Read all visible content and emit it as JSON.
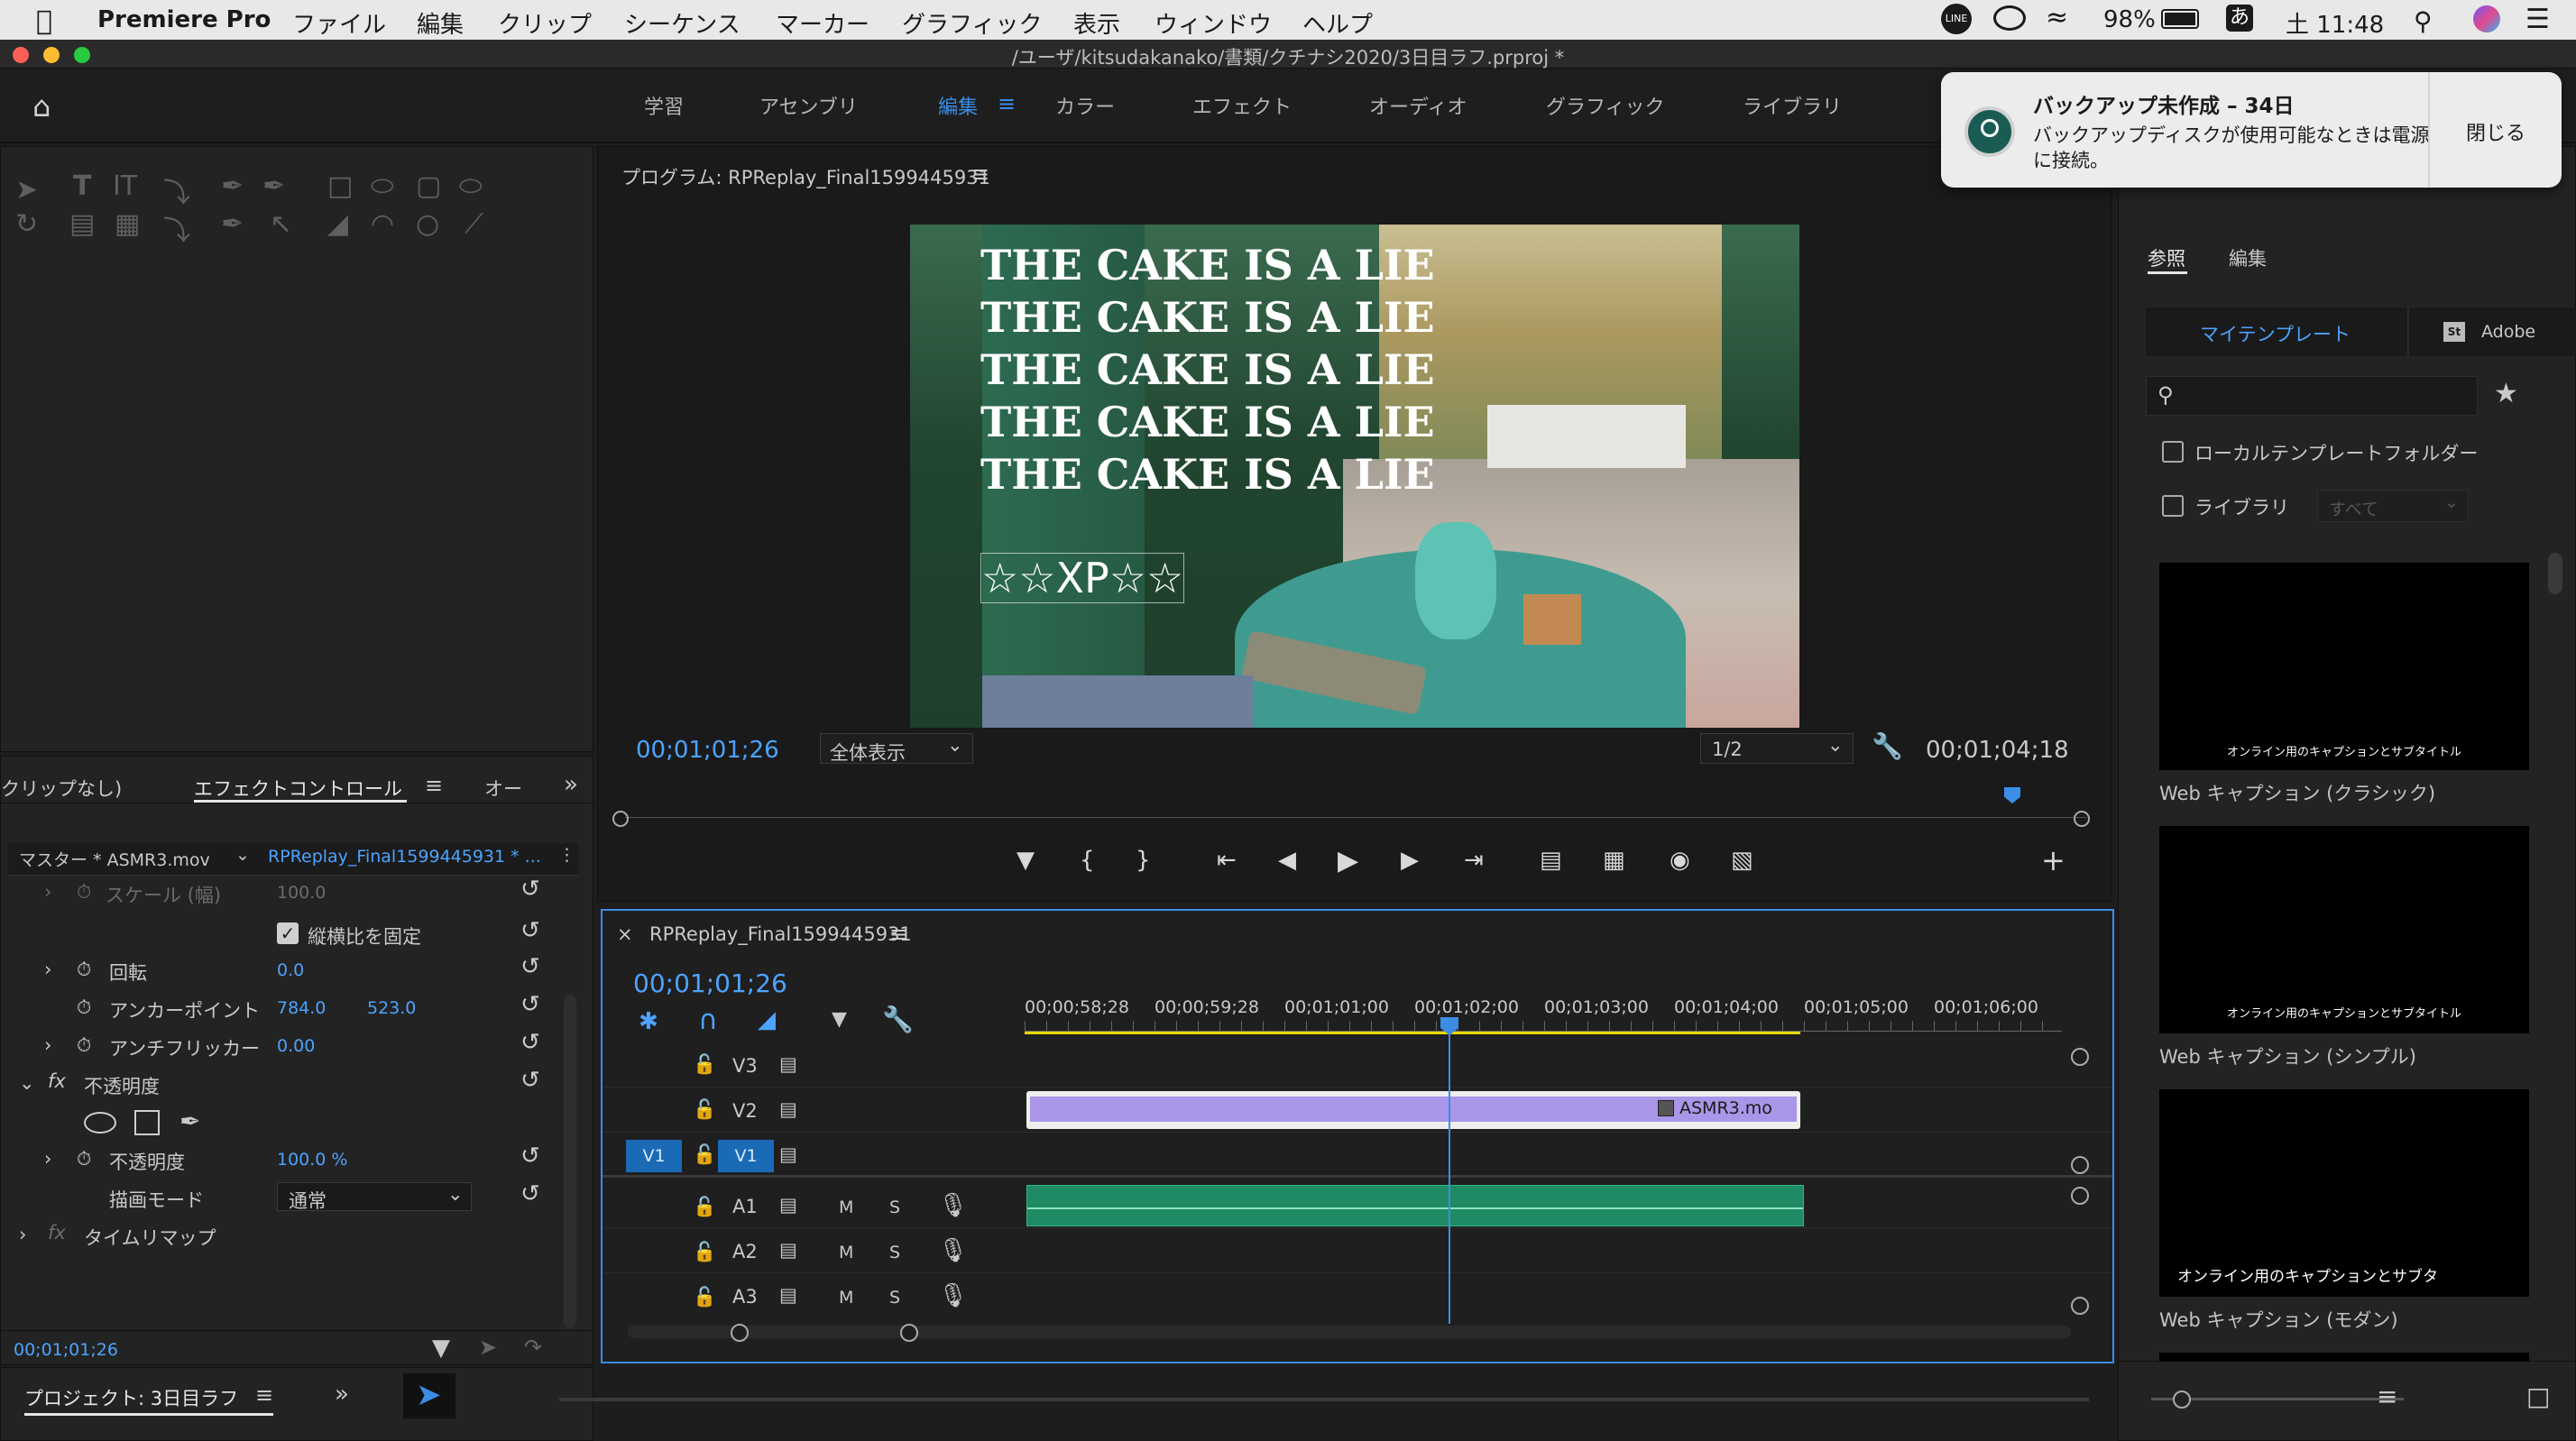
{
  "menubar": {
    "app_name": "Premiere Pro",
    "items": [
      "ファイル",
      "編集",
      "クリップ",
      "シーケンス",
      "マーカー",
      "グラフィック",
      "表示",
      "ウィンドウ",
      "ヘルプ"
    ],
    "battery": "98%",
    "input_mode": "あ",
    "clock": "土 11:48"
  },
  "titlebar": {
    "path": "/ユーザ/kitsudakanako/書類/クチナシ2020/3日目ラフ.prproj *"
  },
  "workspaces": [
    "学習",
    "アセンブリ",
    "編集",
    "カラー",
    "エフェクト",
    "オーディオ",
    "グラフィック",
    "ライブラリ"
  ],
  "notification": {
    "title": "バックアップ未作成 – 34日",
    "body_line1": "バックアップディスクが使用可能なときは電源",
    "body_line2": "に接続。",
    "close": "閉じる"
  },
  "program_monitor": {
    "title": "プログラム: RPReplay_Final1599445931",
    "overlay_lines": [
      "THE CAKE IS A LIE",
      "THE CAKE IS A LIE",
      "THE CAKE IS A LIE",
      "THE CAKE IS A LIE",
      "THE CAKE IS A LIE"
    ],
    "overlay_xp": "☆☆XP☆☆",
    "timecode": "00;01;01;26",
    "fit": "全体表示",
    "resolution": "1/2",
    "duration": "00;01;04;18"
  },
  "effect_controls": {
    "tab_clip": "クリップなし)",
    "tab_effects": "エフェクトコントロール",
    "tab_other": "オー",
    "master": "マスター * ASMR3.mov",
    "sequence": "RPReplay_Final1599445931 * ...",
    "rows": {
      "scale_w": "スケール (幅)",
      "scale_w_val": "100.0",
      "lock_ratio": "縦横比を固定",
      "rotation": "回転",
      "rotation_val": "0.0",
      "anchor": "アンカーポイント",
      "anchor_x": "784.0",
      "anchor_y": "523.0",
      "antiflicker": "アンチフリッカー",
      "antiflicker_val": "0.00",
      "opacity_group": "不透明度",
      "opacity": "不透明度",
      "opacity_val": "100.0 %",
      "blend": "描画モード",
      "blend_val": "通常",
      "timeremap": "タイムリマップ"
    },
    "timecode": "00;01;01;26"
  },
  "project": {
    "title": "プロジェクト: 3日目ラフ"
  },
  "timeline": {
    "title": "RPReplay_Final1599445931",
    "timecode": "00;01;01;26",
    "ruler": [
      "00;00;58;28",
      "00;00;59;28",
      "00;01;01;00",
      "00;01;02;00",
      "00;01;03;00",
      "00;01;04;00",
      "00;01;05;00",
      "00;01;06;00"
    ],
    "video_tracks": [
      "V3",
      "V2",
      "V1"
    ],
    "audio_tracks": [
      "A1",
      "A2",
      "A3"
    ],
    "source_patch": "V1",
    "clip_name": "ASMR3.mo",
    "m_label": "M",
    "s_label": "S"
  },
  "essential_graphics": {
    "tab_browse": "参照",
    "tab_edit": "編集",
    "my_templates": "マイテンプレート",
    "adobe": "Adobe",
    "local_folder": "ローカルテンプレートフォルダー",
    "library": "ライブラリ",
    "library_select": "すべて",
    "templates": [
      {
        "caption": "オンライン用のキャプションとサブタイトル",
        "name": "Web キャプション (クラシック)"
      },
      {
        "caption": "オンライン用のキャプションとサブタイトル",
        "name": "Web キャプション (シンプル)"
      },
      {
        "caption": "オンライン用のキャプションとサブタ",
        "name": "Web キャプション (モダン)"
      }
    ]
  }
}
